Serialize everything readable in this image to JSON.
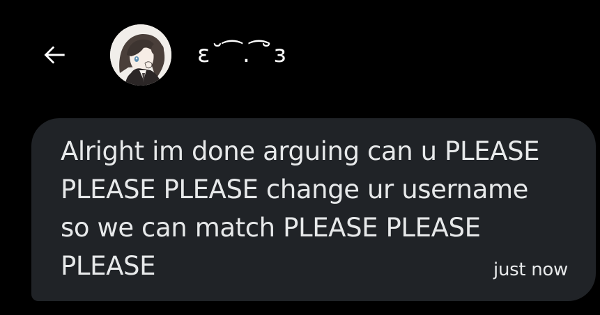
{
  "header": {
    "back_icon": "arrow-left-icon",
    "avatar_icon": "anime-avatar",
    "display_name": "ɛ˘ ͡ . ͡˘ɜ"
  },
  "message": {
    "text": "Alright im done arguing can u PLEASE\nPLEASE PLEASE change ur username\nso we can match PLEASE PLEASE\nPLEASE",
    "timestamp": "just now"
  },
  "colors": {
    "background": "#000000",
    "bubble": "#202327",
    "text": "#e7e9ea"
  }
}
